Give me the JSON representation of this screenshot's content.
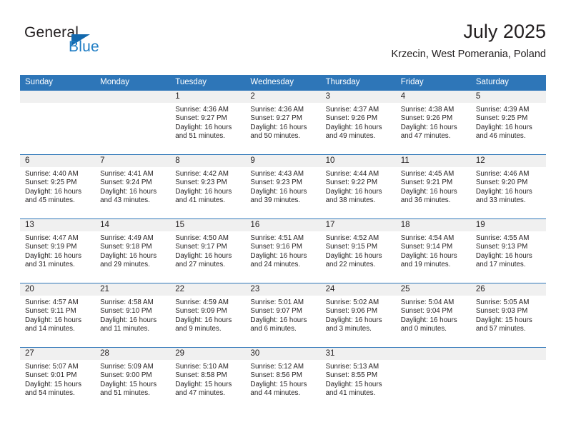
{
  "brand": {
    "name_part1": "General",
    "name_part2": "Blue",
    "triangle_color": "#1268ad",
    "blue_color": "#1d7cc4"
  },
  "header": {
    "title": "July 2025",
    "location": "Krzecin, West Pomerania, Poland",
    "accent_color": "#2e76b8",
    "band_color": "#f0f0f0"
  },
  "weekdays": [
    "Sunday",
    "Monday",
    "Tuesday",
    "Wednesday",
    "Thursday",
    "Friday",
    "Saturday"
  ],
  "weeks": [
    [
      {
        "day": "",
        "sunrise": "",
        "sunset": "",
        "daylight_line1": "",
        "daylight_line2": "",
        "empty": true
      },
      {
        "day": "",
        "sunrise": "",
        "sunset": "",
        "daylight_line1": "",
        "daylight_line2": "",
        "empty": true
      },
      {
        "day": "1",
        "sunrise": "Sunrise: 4:36 AM",
        "sunset": "Sunset: 9:27 PM",
        "daylight_line1": "Daylight: 16 hours",
        "daylight_line2": "and 51 minutes."
      },
      {
        "day": "2",
        "sunrise": "Sunrise: 4:36 AM",
        "sunset": "Sunset: 9:27 PM",
        "daylight_line1": "Daylight: 16 hours",
        "daylight_line2": "and 50 minutes."
      },
      {
        "day": "3",
        "sunrise": "Sunrise: 4:37 AM",
        "sunset": "Sunset: 9:26 PM",
        "daylight_line1": "Daylight: 16 hours",
        "daylight_line2": "and 49 minutes."
      },
      {
        "day": "4",
        "sunrise": "Sunrise: 4:38 AM",
        "sunset": "Sunset: 9:26 PM",
        "daylight_line1": "Daylight: 16 hours",
        "daylight_line2": "and 47 minutes."
      },
      {
        "day": "5",
        "sunrise": "Sunrise: 4:39 AM",
        "sunset": "Sunset: 9:25 PM",
        "daylight_line1": "Daylight: 16 hours",
        "daylight_line2": "and 46 minutes."
      }
    ],
    [
      {
        "day": "6",
        "sunrise": "Sunrise: 4:40 AM",
        "sunset": "Sunset: 9:25 PM",
        "daylight_line1": "Daylight: 16 hours",
        "daylight_line2": "and 45 minutes."
      },
      {
        "day": "7",
        "sunrise": "Sunrise: 4:41 AM",
        "sunset": "Sunset: 9:24 PM",
        "daylight_line1": "Daylight: 16 hours",
        "daylight_line2": "and 43 minutes."
      },
      {
        "day": "8",
        "sunrise": "Sunrise: 4:42 AM",
        "sunset": "Sunset: 9:23 PM",
        "daylight_line1": "Daylight: 16 hours",
        "daylight_line2": "and 41 minutes."
      },
      {
        "day": "9",
        "sunrise": "Sunrise: 4:43 AM",
        "sunset": "Sunset: 9:23 PM",
        "daylight_line1": "Daylight: 16 hours",
        "daylight_line2": "and 39 minutes."
      },
      {
        "day": "10",
        "sunrise": "Sunrise: 4:44 AM",
        "sunset": "Sunset: 9:22 PM",
        "daylight_line1": "Daylight: 16 hours",
        "daylight_line2": "and 38 minutes."
      },
      {
        "day": "11",
        "sunrise": "Sunrise: 4:45 AM",
        "sunset": "Sunset: 9:21 PM",
        "daylight_line1": "Daylight: 16 hours",
        "daylight_line2": "and 36 minutes."
      },
      {
        "day": "12",
        "sunrise": "Sunrise: 4:46 AM",
        "sunset": "Sunset: 9:20 PM",
        "daylight_line1": "Daylight: 16 hours",
        "daylight_line2": "and 33 minutes."
      }
    ],
    [
      {
        "day": "13",
        "sunrise": "Sunrise: 4:47 AM",
        "sunset": "Sunset: 9:19 PM",
        "daylight_line1": "Daylight: 16 hours",
        "daylight_line2": "and 31 minutes."
      },
      {
        "day": "14",
        "sunrise": "Sunrise: 4:49 AM",
        "sunset": "Sunset: 9:18 PM",
        "daylight_line1": "Daylight: 16 hours",
        "daylight_line2": "and 29 minutes."
      },
      {
        "day": "15",
        "sunrise": "Sunrise: 4:50 AM",
        "sunset": "Sunset: 9:17 PM",
        "daylight_line1": "Daylight: 16 hours",
        "daylight_line2": "and 27 minutes."
      },
      {
        "day": "16",
        "sunrise": "Sunrise: 4:51 AM",
        "sunset": "Sunset: 9:16 PM",
        "daylight_line1": "Daylight: 16 hours",
        "daylight_line2": "and 24 minutes."
      },
      {
        "day": "17",
        "sunrise": "Sunrise: 4:52 AM",
        "sunset": "Sunset: 9:15 PM",
        "daylight_line1": "Daylight: 16 hours",
        "daylight_line2": "and 22 minutes."
      },
      {
        "day": "18",
        "sunrise": "Sunrise: 4:54 AM",
        "sunset": "Sunset: 9:14 PM",
        "daylight_line1": "Daylight: 16 hours",
        "daylight_line2": "and 19 minutes."
      },
      {
        "day": "19",
        "sunrise": "Sunrise: 4:55 AM",
        "sunset": "Sunset: 9:13 PM",
        "daylight_line1": "Daylight: 16 hours",
        "daylight_line2": "and 17 minutes."
      }
    ],
    [
      {
        "day": "20",
        "sunrise": "Sunrise: 4:57 AM",
        "sunset": "Sunset: 9:11 PM",
        "daylight_line1": "Daylight: 16 hours",
        "daylight_line2": "and 14 minutes."
      },
      {
        "day": "21",
        "sunrise": "Sunrise: 4:58 AM",
        "sunset": "Sunset: 9:10 PM",
        "daylight_line1": "Daylight: 16 hours",
        "daylight_line2": "and 11 minutes."
      },
      {
        "day": "22",
        "sunrise": "Sunrise: 4:59 AM",
        "sunset": "Sunset: 9:09 PM",
        "daylight_line1": "Daylight: 16 hours",
        "daylight_line2": "and 9 minutes."
      },
      {
        "day": "23",
        "sunrise": "Sunrise: 5:01 AM",
        "sunset": "Sunset: 9:07 PM",
        "daylight_line1": "Daylight: 16 hours",
        "daylight_line2": "and 6 minutes."
      },
      {
        "day": "24",
        "sunrise": "Sunrise: 5:02 AM",
        "sunset": "Sunset: 9:06 PM",
        "daylight_line1": "Daylight: 16 hours",
        "daylight_line2": "and 3 minutes."
      },
      {
        "day": "25",
        "sunrise": "Sunrise: 5:04 AM",
        "sunset": "Sunset: 9:04 PM",
        "daylight_line1": "Daylight: 16 hours",
        "daylight_line2": "and 0 minutes."
      },
      {
        "day": "26",
        "sunrise": "Sunrise: 5:05 AM",
        "sunset": "Sunset: 9:03 PM",
        "daylight_line1": "Daylight: 15 hours",
        "daylight_line2": "and 57 minutes."
      }
    ],
    [
      {
        "day": "27",
        "sunrise": "Sunrise: 5:07 AM",
        "sunset": "Sunset: 9:01 PM",
        "daylight_line1": "Daylight: 15 hours",
        "daylight_line2": "and 54 minutes."
      },
      {
        "day": "28",
        "sunrise": "Sunrise: 5:09 AM",
        "sunset": "Sunset: 9:00 PM",
        "daylight_line1": "Daylight: 15 hours",
        "daylight_line2": "and 51 minutes."
      },
      {
        "day": "29",
        "sunrise": "Sunrise: 5:10 AM",
        "sunset": "Sunset: 8:58 PM",
        "daylight_line1": "Daylight: 15 hours",
        "daylight_line2": "and 47 minutes."
      },
      {
        "day": "30",
        "sunrise": "Sunrise: 5:12 AM",
        "sunset": "Sunset: 8:56 PM",
        "daylight_line1": "Daylight: 15 hours",
        "daylight_line2": "and 44 minutes."
      },
      {
        "day": "31",
        "sunrise": "Sunrise: 5:13 AM",
        "sunset": "Sunset: 8:55 PM",
        "daylight_line1": "Daylight: 15 hours",
        "daylight_line2": "and 41 minutes."
      },
      {
        "day": "",
        "sunrise": "",
        "sunset": "",
        "daylight_line1": "",
        "daylight_line2": "",
        "empty": true
      },
      {
        "day": "",
        "sunrise": "",
        "sunset": "",
        "daylight_line1": "",
        "daylight_line2": "",
        "empty": true
      }
    ]
  ]
}
